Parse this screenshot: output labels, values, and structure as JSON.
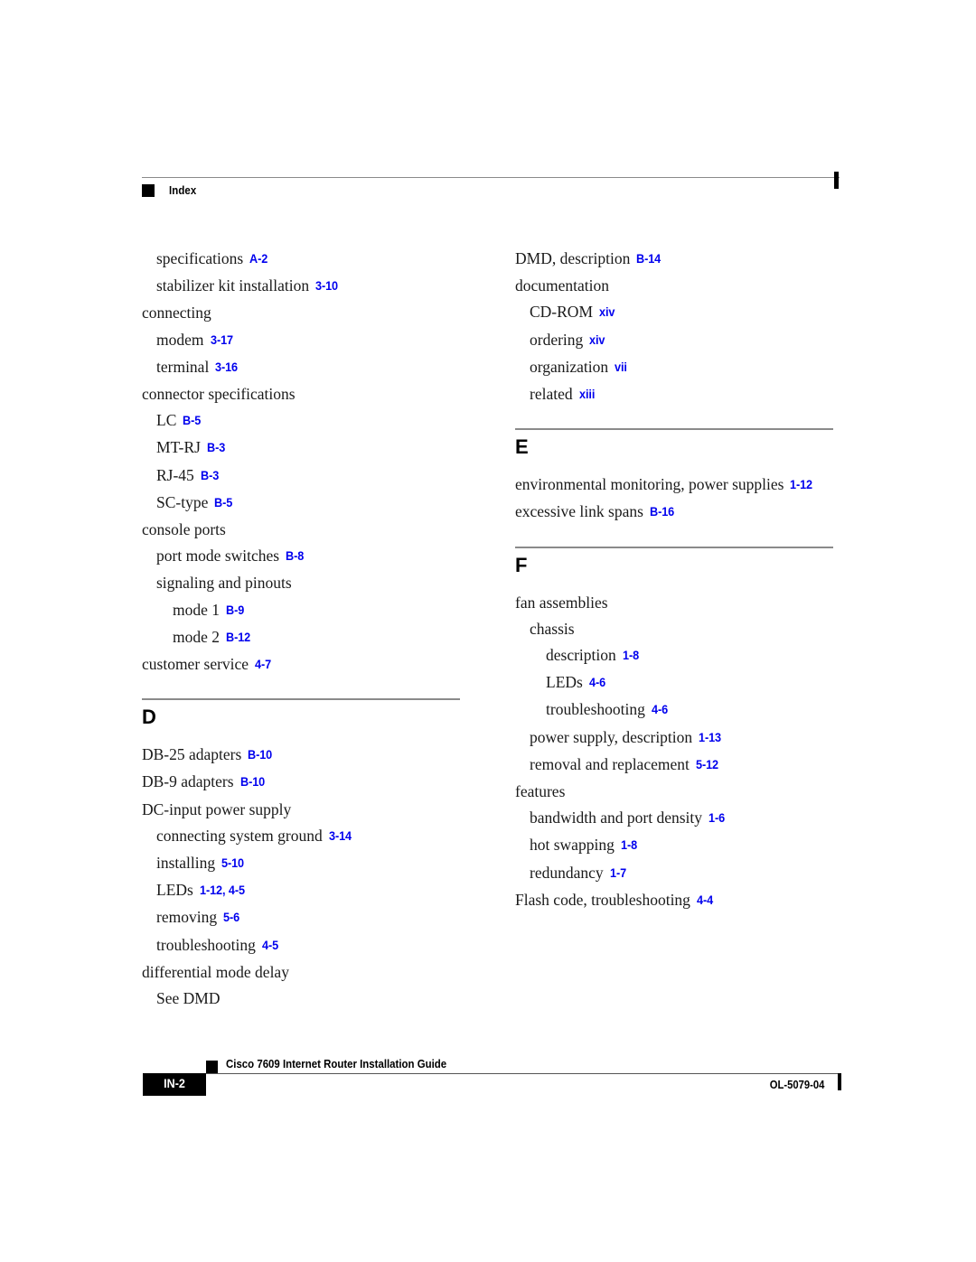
{
  "header": {
    "title": "Index",
    "square_color": "#000000",
    "rule_color": "#8a8a8a"
  },
  "theme": {
    "reference_color": "#0000ee",
    "text_color": "#1a1a1a",
    "rule_color": "#8a8a8a"
  },
  "columns": {
    "left": {
      "blocks": [
        {
          "type": "entries",
          "entries": [
            {
              "level": 1,
              "term": "specifications",
              "ref": "A-2"
            },
            {
              "level": 1,
              "term": "stabilizer kit installation",
              "ref": "3-10"
            },
            {
              "level": 0,
              "term": "connecting",
              "ref": ""
            },
            {
              "level": 1,
              "term": "modem",
              "ref": "3-17"
            },
            {
              "level": 1,
              "term": "terminal",
              "ref": "3-16"
            },
            {
              "level": 0,
              "term": "connector specifications",
              "ref": ""
            },
            {
              "level": 1,
              "term": "LC",
              "ref": "B-5"
            },
            {
              "level": 1,
              "term": "MT-RJ",
              "ref": "B-3"
            },
            {
              "level": 1,
              "term": "RJ-45",
              "ref": "B-3"
            },
            {
              "level": 1,
              "term": "SC-type",
              "ref": "B-5"
            },
            {
              "level": 0,
              "term": "console ports",
              "ref": ""
            },
            {
              "level": 1,
              "term": "port mode switches",
              "ref": "B-8"
            },
            {
              "level": 1,
              "term": "signaling and pinouts",
              "ref": ""
            },
            {
              "level": 2,
              "term": "mode 1",
              "ref": "B-9"
            },
            {
              "level": 2,
              "term": "mode 2",
              "ref": "B-12"
            },
            {
              "level": 0,
              "term": "customer service",
              "ref": "4-7"
            }
          ]
        },
        {
          "type": "group",
          "letter": "D",
          "entries": [
            {
              "level": 0,
              "term": "DB-25 adapters",
              "ref": "B-10"
            },
            {
              "level": 0,
              "term": "DB-9 adapters",
              "ref": "B-10"
            },
            {
              "level": 0,
              "term": "DC-input power supply",
              "ref": ""
            },
            {
              "level": 1,
              "term": "connecting system ground",
              "ref": "3-14"
            },
            {
              "level": 1,
              "term": "installing",
              "ref": "5-10"
            },
            {
              "level": 1,
              "term": "LEDs",
              "ref": "1-12, 4-5"
            },
            {
              "level": 1,
              "term": "removing",
              "ref": "5-6"
            },
            {
              "level": 1,
              "term": "troubleshooting",
              "ref": "4-5"
            },
            {
              "level": 0,
              "term": "differential mode delay",
              "ref": ""
            },
            {
              "level": 1,
              "term": "See DMD",
              "ref": ""
            }
          ]
        }
      ]
    },
    "right": {
      "blocks": [
        {
          "type": "entries",
          "entries": [
            {
              "level": 0,
              "term": "DMD, description",
              "ref": "B-14"
            },
            {
              "level": 0,
              "term": "documentation",
              "ref": ""
            },
            {
              "level": 1,
              "term": "CD-ROM",
              "ref": "xiv"
            },
            {
              "level": 1,
              "term": "ordering",
              "ref": "xiv"
            },
            {
              "level": 1,
              "term": "organization",
              "ref": "vii"
            },
            {
              "level": 1,
              "term": "related",
              "ref": "xiii"
            }
          ]
        },
        {
          "type": "group",
          "letter": "E",
          "entries": [
            {
              "level": 0,
              "term": "environmental monitoring, power supplies",
              "ref": "1-12"
            },
            {
              "level": 0,
              "term": "excessive link spans",
              "ref": "B-16"
            }
          ]
        },
        {
          "type": "group",
          "letter": "F",
          "entries": [
            {
              "level": 0,
              "term": "fan assemblies",
              "ref": ""
            },
            {
              "level": 1,
              "term": "chassis",
              "ref": ""
            },
            {
              "level": 2,
              "term": "description",
              "ref": "1-8"
            },
            {
              "level": 2,
              "term": "LEDs",
              "ref": "4-6"
            },
            {
              "level": 2,
              "term": "troubleshooting",
              "ref": "4-6"
            },
            {
              "level": 1,
              "term": "power supply, description",
              "ref": "1-13"
            },
            {
              "level": 1,
              "term": "removal and replacement",
              "ref": "5-12"
            },
            {
              "level": 0,
              "term": "features",
              "ref": ""
            },
            {
              "level": 1,
              "term": "bandwidth and port density",
              "ref": "1-6"
            },
            {
              "level": 1,
              "term": "hot swapping",
              "ref": "1-8"
            },
            {
              "level": 1,
              "term": "redundancy",
              "ref": "1-7"
            },
            {
              "level": 0,
              "term": "Flash code, troubleshooting",
              "ref": "4-4"
            }
          ]
        }
      ]
    }
  },
  "footer": {
    "page_number": "IN-2",
    "document_title": "Cisco 7609 Internet Router Installation Guide",
    "document_id": "OL-5079-04"
  }
}
